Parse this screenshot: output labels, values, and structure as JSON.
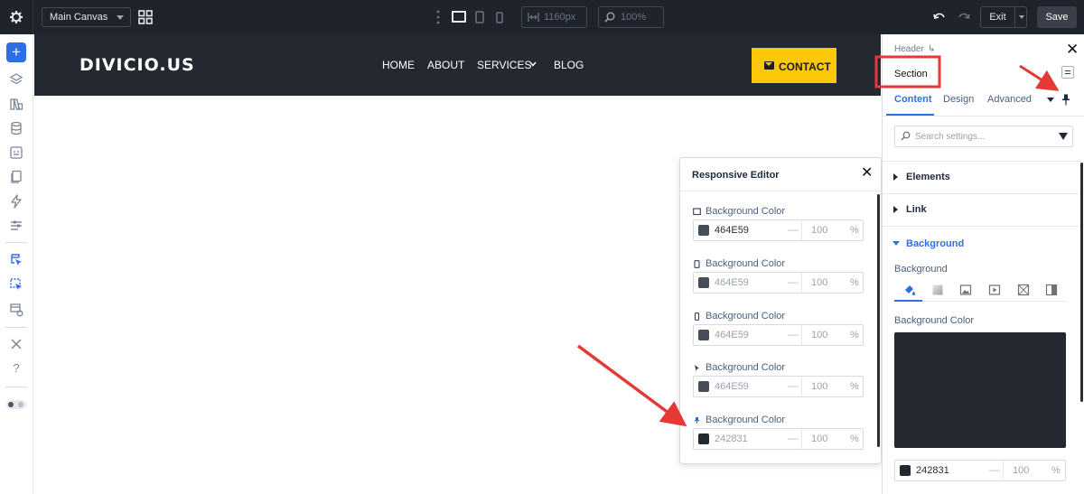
{
  "topbar": {
    "canvas_select": "Main Canvas",
    "width_value": "1160px",
    "zoom_value": "100%",
    "exit_label": "Exit",
    "save_label": "Save"
  },
  "site": {
    "logo": "DIVICIO.US",
    "nav": [
      "HOME",
      "ABOUT",
      "SERVICES",
      "BLOG"
    ],
    "contact": "CONTACT"
  },
  "popup": {
    "title": "Responsive Editor",
    "rows": [
      {
        "device": "desktop",
        "label": "Background Color",
        "hex": "464E59",
        "opacity_placeholder": "100",
        "unit": "%",
        "swatch": "#464e59",
        "active": true
      },
      {
        "device": "tablet",
        "label": "Background Color",
        "hex": "464E59",
        "opacity_placeholder": "100",
        "unit": "%",
        "swatch": "#464e59",
        "active": false
      },
      {
        "device": "phone",
        "label": "Background Color",
        "hex": "464E59",
        "opacity_placeholder": "100",
        "unit": "%",
        "swatch": "#464e59",
        "active": false
      },
      {
        "device": "hover",
        "label": "Background Color",
        "hex": "464E59",
        "opacity_placeholder": "100",
        "unit": "%",
        "swatch": "#464e59",
        "active": false
      },
      {
        "device": "sticky",
        "label": "Background Color",
        "hex": "242831",
        "opacity_placeholder": "100",
        "unit": "%",
        "swatch": "#242831",
        "active": false
      }
    ]
  },
  "panel": {
    "breadcrumb": "Header",
    "module_name": "Section",
    "tabs": [
      "Content",
      "Design",
      "Advanced"
    ],
    "search_placeholder": "Search settings...",
    "groups": [
      "Elements",
      "Link",
      "Background"
    ],
    "background_label": "Background",
    "background_color_label": "Background Color",
    "color_hex": "242831",
    "opacity_placeholder": "100",
    "unit": "%",
    "color": "#242831"
  },
  "colors": {
    "accent": "#2f6fe4",
    "header_bg": "#242831",
    "contact_bg": "#fdc80a",
    "annotation": "#e53935"
  }
}
